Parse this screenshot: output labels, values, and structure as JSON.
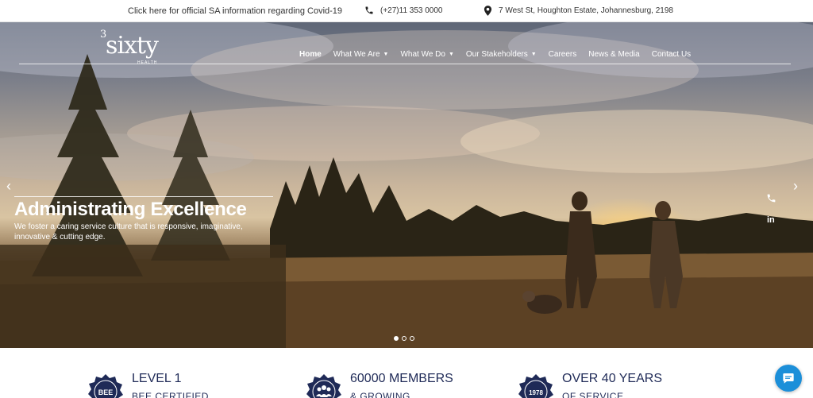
{
  "topbar": {
    "covid_link": "Click here for official SA information regarding Covid-19",
    "phone": "(+27)11 353 0000",
    "address": "7 West St, Houghton Estate, Johannesburg, 2198"
  },
  "logo": {
    "superscript": "3",
    "word": "sixty",
    "tag": "HEALTH"
  },
  "nav": {
    "items": [
      {
        "label": "Home"
      },
      {
        "label": "What We Are"
      },
      {
        "label": "What We Do"
      },
      {
        "label": "Our Stakeholders"
      },
      {
        "label": "Careers"
      },
      {
        "label": "News & Media"
      },
      {
        "label": "Contact Us"
      }
    ]
  },
  "hero": {
    "headline": "Administrating Excellence",
    "subline": "We foster a caring service culture that is responsive, imaginative, innovative & cutting edge.",
    "slide_count": 3,
    "active_slide": 1,
    "linkedin_label": "in"
  },
  "stats": [
    {
      "title": "LEVEL 1",
      "sub": "BEE CERTIFIED",
      "badge": "BEE"
    },
    {
      "title": "60000 MEMBERS",
      "sub": "& GROWING",
      "badge": ""
    },
    {
      "title": "OVER 40 YEARS",
      "sub": "OF SERVICE",
      "badge": "1978"
    }
  ],
  "colors": {
    "brand_navy": "#1f2a57",
    "chat_blue": "#1c8fd9"
  },
  "icons": {
    "topbar_phone": "phone-icon",
    "topbar_address": "map-pin-icon",
    "chat": "chat-bubble-icon",
    "social_phone": "phone-icon",
    "social_linkedin": "linkedin-icon"
  }
}
